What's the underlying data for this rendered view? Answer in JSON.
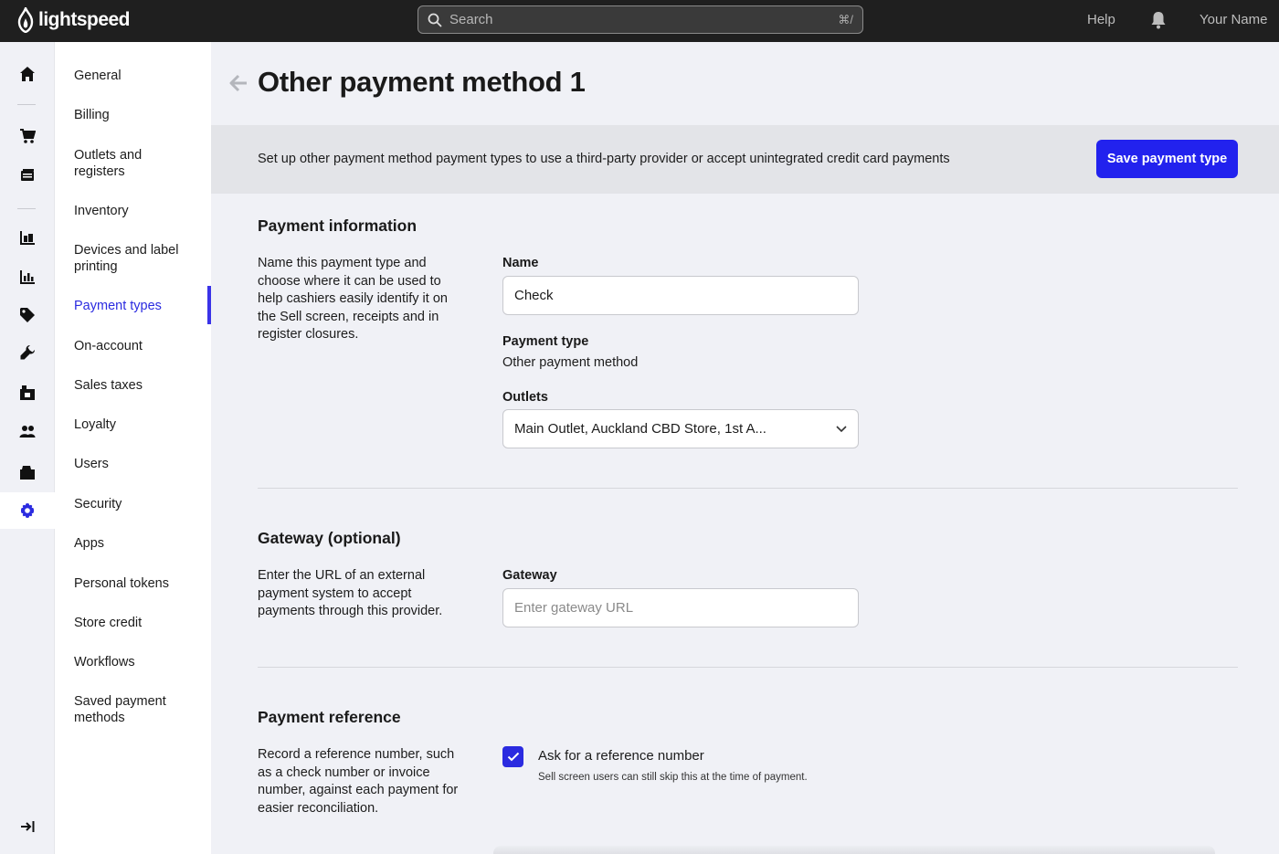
{
  "topbar": {
    "brand": "lightspeed",
    "search_placeholder": "Search",
    "search_shortcut": "⌘/",
    "help_label": "Help",
    "user_name": "Your Name"
  },
  "rail": {
    "items": [
      "home-icon",
      "cart-icon",
      "catalog-icon",
      "inventory-icon",
      "reports-icon",
      "tag-icon",
      "wrench-icon",
      "store-icon",
      "customers-icon",
      "register-icon",
      "gear-icon"
    ],
    "active": "gear-icon",
    "collapse_icon": "collapse-icon"
  },
  "subnav": {
    "items": [
      {
        "label": "General"
      },
      {
        "label": "Billing"
      },
      {
        "label": "Outlets and registers"
      },
      {
        "label": "Inventory"
      },
      {
        "label": "Devices and label printing"
      },
      {
        "label": "Payment types"
      },
      {
        "label": "On-account"
      },
      {
        "label": "Sales taxes"
      },
      {
        "label": "Loyalty"
      },
      {
        "label": "Users"
      },
      {
        "label": "Security"
      },
      {
        "label": "Apps"
      },
      {
        "label": "Personal tokens"
      },
      {
        "label": "Store credit"
      },
      {
        "label": "Workflows"
      },
      {
        "label": "Saved payment methods"
      }
    ],
    "active": "Payment types"
  },
  "page": {
    "title": "Other payment method 1",
    "banner_text": "Set up other payment method payment types to use a third-party provider or accept unintegrated credit card payments",
    "save_label": "Save payment type"
  },
  "payment_info": {
    "title": "Payment information",
    "description": "Name this payment type and choose where it can be used to help cashiers easily identify it on the Sell screen, receipts and in register closures.",
    "name_label": "Name",
    "name_value": "Check",
    "type_label": "Payment type",
    "type_value": "Other payment method",
    "outlets_label": "Outlets",
    "outlets_value": "Main Outlet, Auckland CBD Store, 1st A..."
  },
  "gateway": {
    "title": "Gateway (optional)",
    "description": "Enter the URL of an external payment system to accept payments through this provider.",
    "label": "Gateway",
    "placeholder": "Enter gateway URL",
    "value": ""
  },
  "reference": {
    "title": "Payment reference",
    "description": "Record a reference number, such as a check number or invoice number, against each payment for easier reconciliation.",
    "checkbox_label": "Ask for a reference number",
    "checkbox_checked": true,
    "hint": "Sell screen users can still skip this at the time of payment."
  },
  "colors": {
    "accent": "#2222ee",
    "topbar": "#1f1f1f",
    "background": "#f0f1f6"
  }
}
